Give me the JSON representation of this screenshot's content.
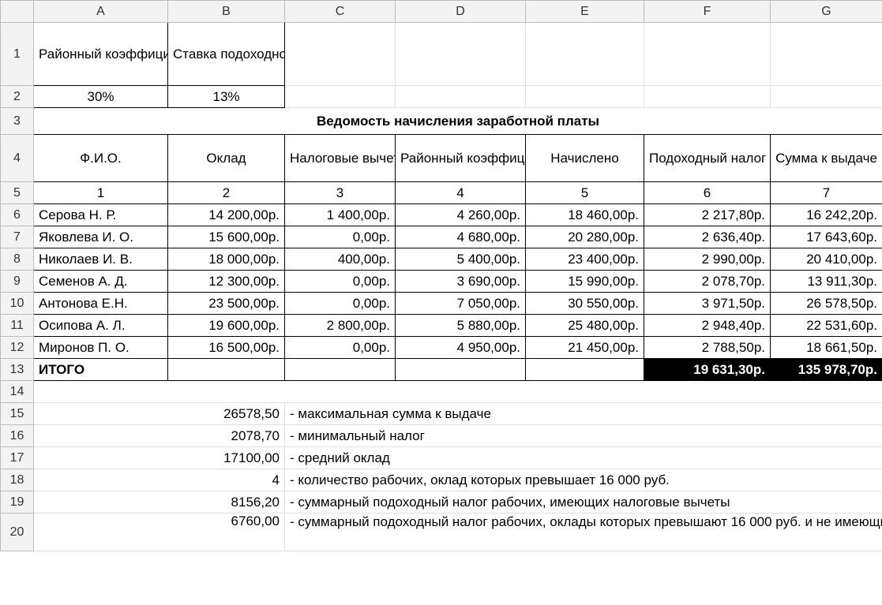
{
  "colHeaders": [
    "A",
    "B",
    "C",
    "D",
    "E",
    "F",
    "G"
  ],
  "rowHeaders": [
    "1",
    "2",
    "3",
    "4",
    "5",
    "6",
    "7",
    "8",
    "9",
    "10",
    "11",
    "12",
    "13",
    "14",
    "15",
    "16",
    "17",
    "18",
    "19",
    "20"
  ],
  "params": {
    "kLabel": "Районный коэффициент (k)",
    "nLabel": "Ставка подоходного налога ( n)",
    "kValue": "30%",
    "nValue": "13%"
  },
  "title": "Ведомость начисления заработной платы",
  "headers": {
    "c1": "Ф.И.О.",
    "c2": "Оклад",
    "c3": "Налоговые вычеты",
    "c4": "Районный коэффициент",
    "c5": "Начислено",
    "c6": "Подоходный налог",
    "c7": "Сумма к выдаче"
  },
  "nums": {
    "c1": "1",
    "c2": "2",
    "c3": "3",
    "c4": "4",
    "c5": "5",
    "c6": "6",
    "c7": "7"
  },
  "rows": [
    {
      "name": "Серова Н. Р.",
      "c2": "14 200,00р.",
      "c3": "1 400,00р.",
      "c4": "4 260,00р.",
      "c5": "18 460,00р.",
      "c6": "2 217,80р.",
      "c7": "16 242,20р."
    },
    {
      "name": "Яковлева И. О.",
      "c2": "15 600,00р.",
      "c3": "0,00р.",
      "c4": "4 680,00р.",
      "c5": "20 280,00р.",
      "c6": "2 636,40р.",
      "c7": "17 643,60р."
    },
    {
      "name": "Николаев И. В.",
      "c2": "18 000,00р.",
      "c3": "400,00р.",
      "c4": "5 400,00р.",
      "c5": "23 400,00р.",
      "c6": "2 990,00р.",
      "c7": "20 410,00р."
    },
    {
      "name": "Семенов А. Д.",
      "c2": "12 300,00р.",
      "c3": "0,00р.",
      "c4": "3 690,00р.",
      "c5": "15 990,00р.",
      "c6": "2 078,70р.",
      "c7": "13 911,30р."
    },
    {
      "name": "Антонова Е.Н.",
      "c2": "23 500,00р.",
      "c3": "0,00р.",
      "c4": "7 050,00р.",
      "c5": "30 550,00р.",
      "c6": "3 971,50р.",
      "c7": "26 578,50р."
    },
    {
      "name": "Осипова А. Л.",
      "c2": "19 600,00р.",
      "c3": "2 800,00р.",
      "c4": "5 880,00р.",
      "c5": "25 480,00р.",
      "c6": "2 948,40р.",
      "c7": "22 531,60р."
    },
    {
      "name": "Миронов П. О.",
      "c2": "16 500,00р.",
      "c3": "0,00р.",
      "c4": "4 950,00р.",
      "c5": "21 450,00р.",
      "c6": "2 788,50р.",
      "c7": "18 661,50р."
    }
  ],
  "totals": {
    "label": "ИТОГО",
    "c6": "19 631,30р.",
    "c7": "135 978,70р."
  },
  "summary": [
    {
      "val": "26578,50",
      "desc": "- максимальная сумма к выдаче"
    },
    {
      "val": "2078,70",
      "desc": "- минимальный налог"
    },
    {
      "val": "17100,00",
      "desc": "- средний оклад"
    },
    {
      "val": "4",
      "desc": "- количество рабочих, оклад которых превышает 16 000 руб."
    },
    {
      "val": "8156,20",
      "desc": "- суммарный подоходный налог рабочих, имеющих налоговые вычеты"
    },
    {
      "val": "6760,00",
      "desc": "- суммарный подоходный налог рабочих, оклады которых превышают 16 000 руб. и не имеющих налоговые вычеты"
    }
  ]
}
